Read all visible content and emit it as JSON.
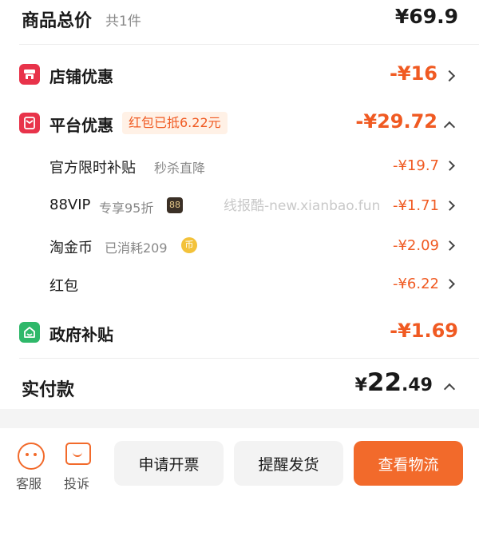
{
  "summary": {
    "title": "商品总价",
    "count": "共1件",
    "total": "¥69.9"
  },
  "store_discount": {
    "label": "店铺优惠",
    "amount": "-¥16"
  },
  "platform_discount": {
    "label": "平台优惠",
    "tag": "红包已抵6.22元",
    "amount": "-¥29.72",
    "items": [
      {
        "label": "官方限时补贴",
        "sub": "秒杀直降",
        "amount": "-¥19.7"
      },
      {
        "label": "88VIP",
        "sub": "专享95折",
        "badge": "88",
        "amount": "-¥1.71"
      },
      {
        "label": "淘金币",
        "sub": "已消耗209",
        "amount": "-¥2.09"
      },
      {
        "label": "红包",
        "sub": "",
        "amount": "-¥6.22"
      }
    ]
  },
  "gov_subsidy": {
    "label": "政府补贴",
    "amount": "-¥1.69"
  },
  "paid": {
    "label": "实付款",
    "currency": "¥",
    "integer": "22",
    "decimal": ".49"
  },
  "watermark": "线报酷-new.xianbao.fun",
  "bottom": {
    "service": "客服",
    "complaint": "投诉",
    "invoice_button": "申请开票",
    "remind_button": "提醒发货",
    "logistics_button": "查看物流"
  },
  "colors": {
    "accent": "#f05a22",
    "store_icon": "#e8334a",
    "gov_icon": "#2fb86a"
  },
  "icons": [
    "store-icon",
    "red-packet-icon",
    "gov-icon",
    "vip-88-badge",
    "coin-icon",
    "service-face-icon",
    "complaint-icon",
    "chevron-right-icon",
    "chevron-up-icon"
  ]
}
